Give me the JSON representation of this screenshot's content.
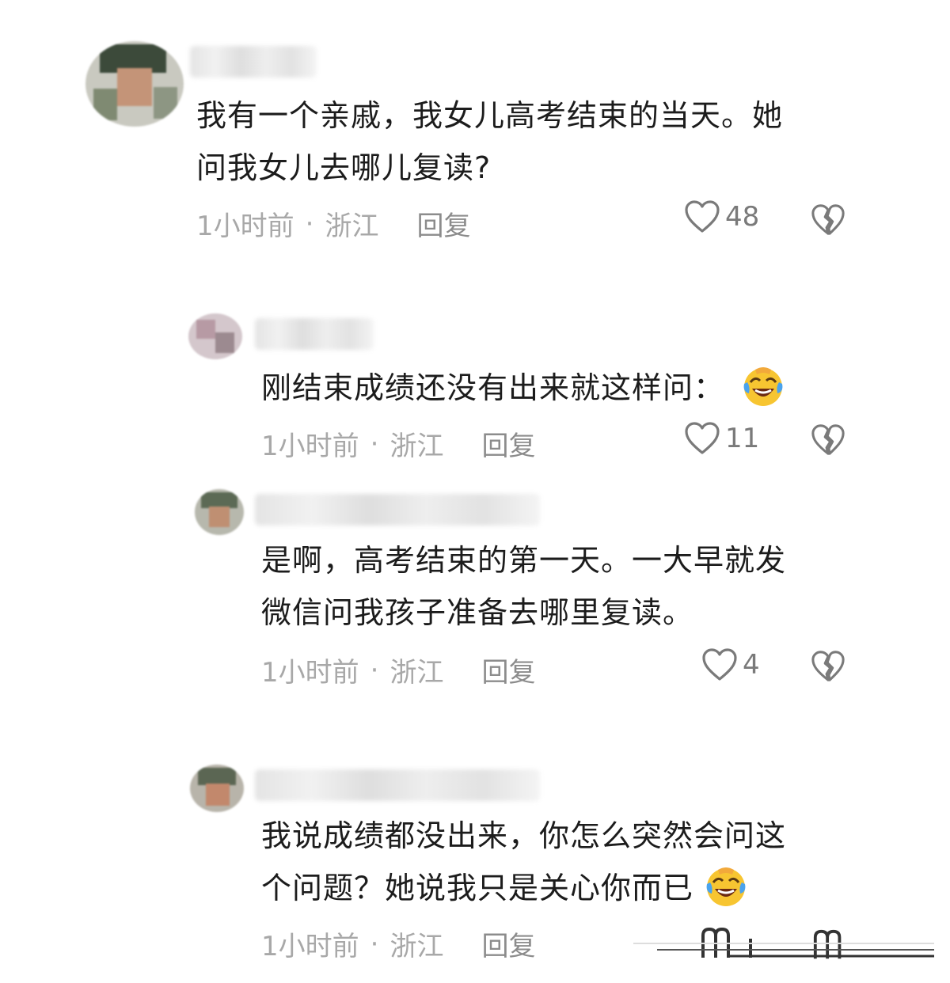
{
  "comments": [
    {
      "lines": [
        "我有一个亲戚，我女儿高考结束的当天。她",
        "问我女儿去哪儿复读?"
      ],
      "time": "1小时前",
      "location": "浙江",
      "reply_label": "回复",
      "likes": "48"
    },
    {
      "lines": [
        "刚结束成绩还没有出来就这样问："
      ],
      "time": "1小时前",
      "location": "浙江",
      "reply_label": "回复",
      "likes": "11"
    },
    {
      "lines": [
        "是啊，高考结束的第一天。一大早就发",
        "微信问我孩子准备去哪里复读。"
      ],
      "time": "1小时前",
      "location": "浙江",
      "reply_label": "回复",
      "likes": "4"
    },
    {
      "lines": [
        "我说成绩都没出来，你怎么突然会问这",
        "个问题？她说我只是关心你而已"
      ],
      "time": "1小时前",
      "location": "浙江",
      "reply_label": "回复",
      "likes": ""
    }
  ],
  "meta_separator": "·",
  "icons": {
    "like": "heart-outline-icon",
    "dislike": "broken-heart-icon",
    "emoji": "laughing-crying-emoji"
  },
  "colors": {
    "text": "#1c1c1c",
    "meta": "#a8a8a8",
    "icon": "#7a7a7a",
    "emoji_face": "#f7c531",
    "emoji_tear": "#4aa3ee"
  }
}
